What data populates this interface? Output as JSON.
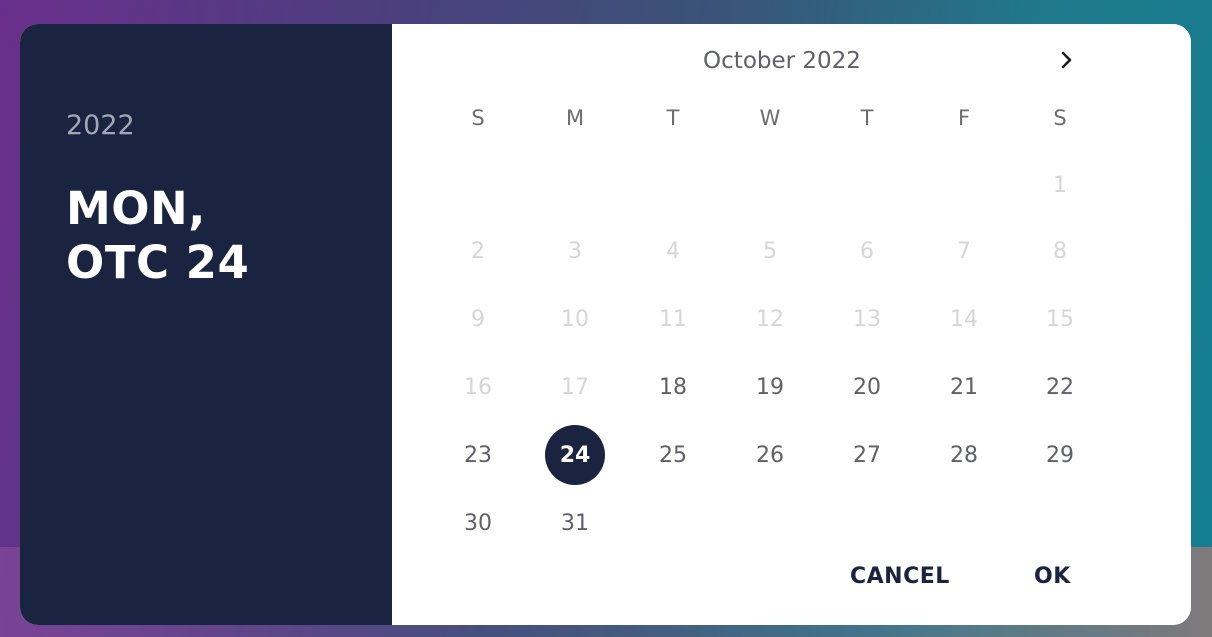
{
  "header": {
    "year": "2022",
    "date_line1": "MON,",
    "date_line2": "OTC 24"
  },
  "calendar": {
    "month_title": "October 2022",
    "next_icon": "chevron-right-icon",
    "weekdays": [
      "S",
      "M",
      "T",
      "W",
      "T",
      "F",
      "S"
    ],
    "days": [
      {
        "label": "1",
        "enabled": false
      },
      {
        "label": "2",
        "enabled": false
      },
      {
        "label": "3",
        "enabled": false
      },
      {
        "label": "4",
        "enabled": false
      },
      {
        "label": "5",
        "enabled": false
      },
      {
        "label": "6",
        "enabled": false
      },
      {
        "label": "7",
        "enabled": false
      },
      {
        "label": "8",
        "enabled": false
      },
      {
        "label": "9",
        "enabled": false
      },
      {
        "label": "10",
        "enabled": false
      },
      {
        "label": "11",
        "enabled": false
      },
      {
        "label": "12",
        "enabled": false
      },
      {
        "label": "13",
        "enabled": false
      },
      {
        "label": "14",
        "enabled": false
      },
      {
        "label": "15",
        "enabled": false
      },
      {
        "label": "16",
        "enabled": false
      },
      {
        "label": "17",
        "enabled": false
      },
      {
        "label": "18",
        "enabled": true
      },
      {
        "label": "19",
        "enabled": true
      },
      {
        "label": "20",
        "enabled": true
      },
      {
        "label": "21",
        "enabled": true
      },
      {
        "label": "22",
        "enabled": true
      },
      {
        "label": "23",
        "enabled": true
      },
      {
        "label": "24",
        "enabled": true,
        "selected": true
      },
      {
        "label": "25",
        "enabled": true
      },
      {
        "label": "26",
        "enabled": true
      },
      {
        "label": "27",
        "enabled": true
      },
      {
        "label": "28",
        "enabled": true
      },
      {
        "label": "29",
        "enabled": true
      },
      {
        "label": "30",
        "enabled": true
      },
      {
        "label": "31",
        "enabled": true
      }
    ]
  },
  "actions": {
    "cancel_label": "CANCEL",
    "ok_label": "OK"
  },
  "colors": {
    "header_bg": "#1a2340",
    "selected_bg": "#1a2340",
    "text": "#5f6068",
    "disabled_text": "#d6d6da"
  }
}
